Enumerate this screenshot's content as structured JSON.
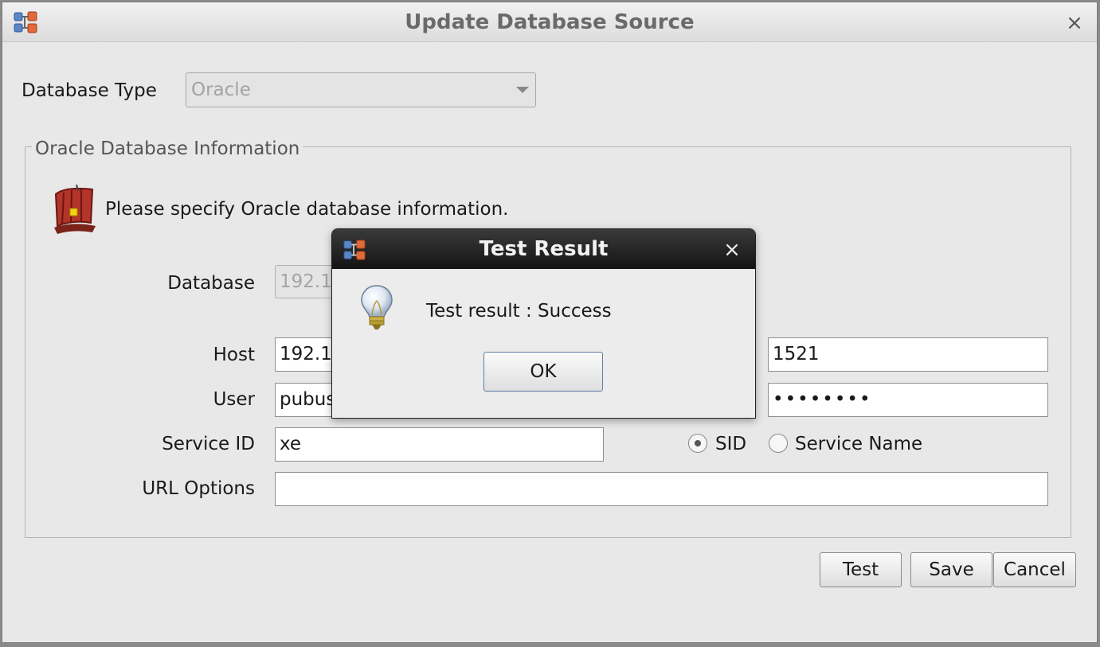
{
  "window": {
    "title": "Update Database Source",
    "close_glyph": "×",
    "icon": "app-connect-icon"
  },
  "database_type": {
    "label": "Database Type",
    "value": "Oracle"
  },
  "group": {
    "title": "Oracle Database Information",
    "hint": "Please specify Oracle database information.",
    "icon": "oracle-ship-icon"
  },
  "fields": {
    "database_label": "Database",
    "database_value": "192.1",
    "host_label": "Host",
    "host_value": "192.1",
    "port_value": "1521",
    "user_label": "User",
    "user_value": "pubus",
    "password_value": "••••••••",
    "service_id_label": "Service ID",
    "service_id_value": "xe",
    "url_options_label": "URL Options",
    "url_options_value": ""
  },
  "service_type": {
    "sid_label": "SID",
    "service_name_label": "Service Name",
    "selected": "SID"
  },
  "buttons": {
    "test": "Test",
    "save": "Save",
    "cancel": "Cancel"
  },
  "dialog": {
    "title": "Test Result",
    "close_glyph": "×",
    "message": "Test result : Success",
    "ok": "OK",
    "icon": "lightbulb-icon"
  },
  "colors": {
    "dialog_titlebar": "#1c1c1c",
    "window_bg": "#e8e8e8",
    "ok_border": "#5f7da3"
  }
}
